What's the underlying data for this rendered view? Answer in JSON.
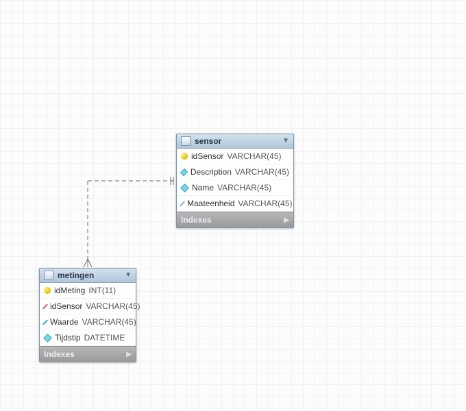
{
  "tables": {
    "sensor": {
      "title": "sensor",
      "indexes_label": "Indexes",
      "cols": {
        "c0": {
          "name": "idSensor",
          "type": "VARCHAR(45)"
        },
        "c1": {
          "name": "Description",
          "type": "VARCHAR(45)"
        },
        "c2": {
          "name": "Name",
          "type": "VARCHAR(45)"
        },
        "c3": {
          "name": "Maateenheid",
          "type": "VARCHAR(45)"
        }
      }
    },
    "metingen": {
      "title": "metingen",
      "indexes_label": "Indexes",
      "cols": {
        "c0": {
          "name": "idMeting",
          "type": "INT(11)"
        },
        "c1": {
          "name": "idSensor",
          "type": "VARCHAR(45)"
        },
        "c2": {
          "name": "Waarde",
          "type": "VARCHAR(45)"
        },
        "c3": {
          "name": "Tijdstip",
          "type": "DATETIME"
        }
      }
    }
  },
  "relationship": {
    "from_table": "metingen",
    "from_column": "idSensor",
    "to_table": "sensor",
    "to_column": "idSensor",
    "cardinality": "many-to-one"
  }
}
